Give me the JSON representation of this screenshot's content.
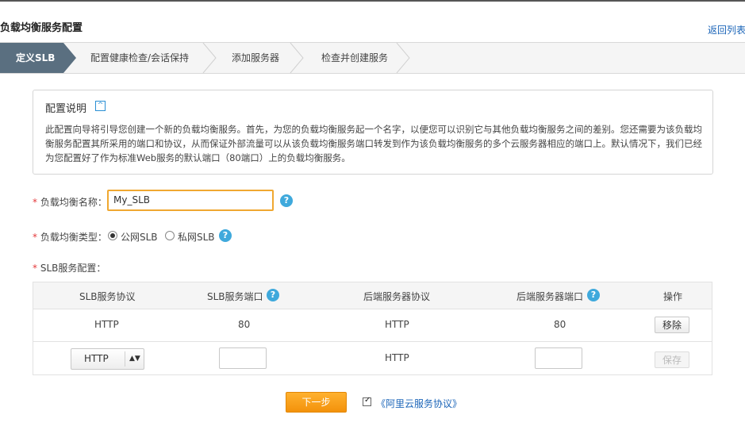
{
  "header": {
    "title": "负载均衡服务配置",
    "back_link": "返回列表"
  },
  "steps": [
    {
      "label": "定义SLB",
      "active": true
    },
    {
      "label": "配置健康检查/会话保持",
      "active": false
    },
    {
      "label": "添加服务器",
      "active": false
    },
    {
      "label": "检查并创建服务",
      "active": false
    }
  ],
  "info": {
    "title": "配置说明",
    "collapse_icon": "^",
    "text": "此配置向导将引导您创建一个新的负载均衡服务。首先，为您的负载均衡服务起一个名字，以便您可以识别它与其他负载均衡服务之间的差别。您还需要为该负载均衡服务配置其所采用的端口和协议，从而保证外部流量可以从该负载均衡服务端口转发到作为该负载均衡服务的多个云服务器相应的端口上。默认情况下，我们已经为您配置好了作为标准Web服务的默认端口（80端口）上的负载均衡服务。"
  },
  "form": {
    "required_mark": "*",
    "name_label": "负载均衡名称：",
    "name_value": "My_SLB",
    "type_label": "负载均衡类型：",
    "type_options": [
      {
        "label": "公网SLB",
        "selected": true
      },
      {
        "label": "私网SLB",
        "selected": false
      }
    ],
    "slb_config_label": "SLB服务配置：",
    "help_glyph": "?"
  },
  "table": {
    "headers": [
      "SLB服务协议",
      "SLB服务端口",
      "后端服务器协议",
      "后端服务器端口",
      "操作"
    ],
    "rows": [
      {
        "protocol": "HTTP",
        "port": "80",
        "backend_protocol": "HTTP",
        "backend_port": "80",
        "action": "移除"
      }
    ],
    "new_row": {
      "protocol_select": "HTTP",
      "select_arrows": "▲▼",
      "port_value": "",
      "backend_protocol": "HTTP",
      "backend_port_value": "",
      "action": "保存"
    }
  },
  "footer": {
    "next_button": "下一步",
    "agreement_checked": true,
    "check_glyph": "✓",
    "agreement_link": "《阿里云服务协议》"
  },
  "colors": {
    "accent_orange": "#f3920b",
    "active_step": "#5a6f80",
    "link_blue": "#1a64b8",
    "help_blue": "#3fa9dc",
    "required_red": "#e4393c",
    "focus_border": "#f0a831"
  }
}
